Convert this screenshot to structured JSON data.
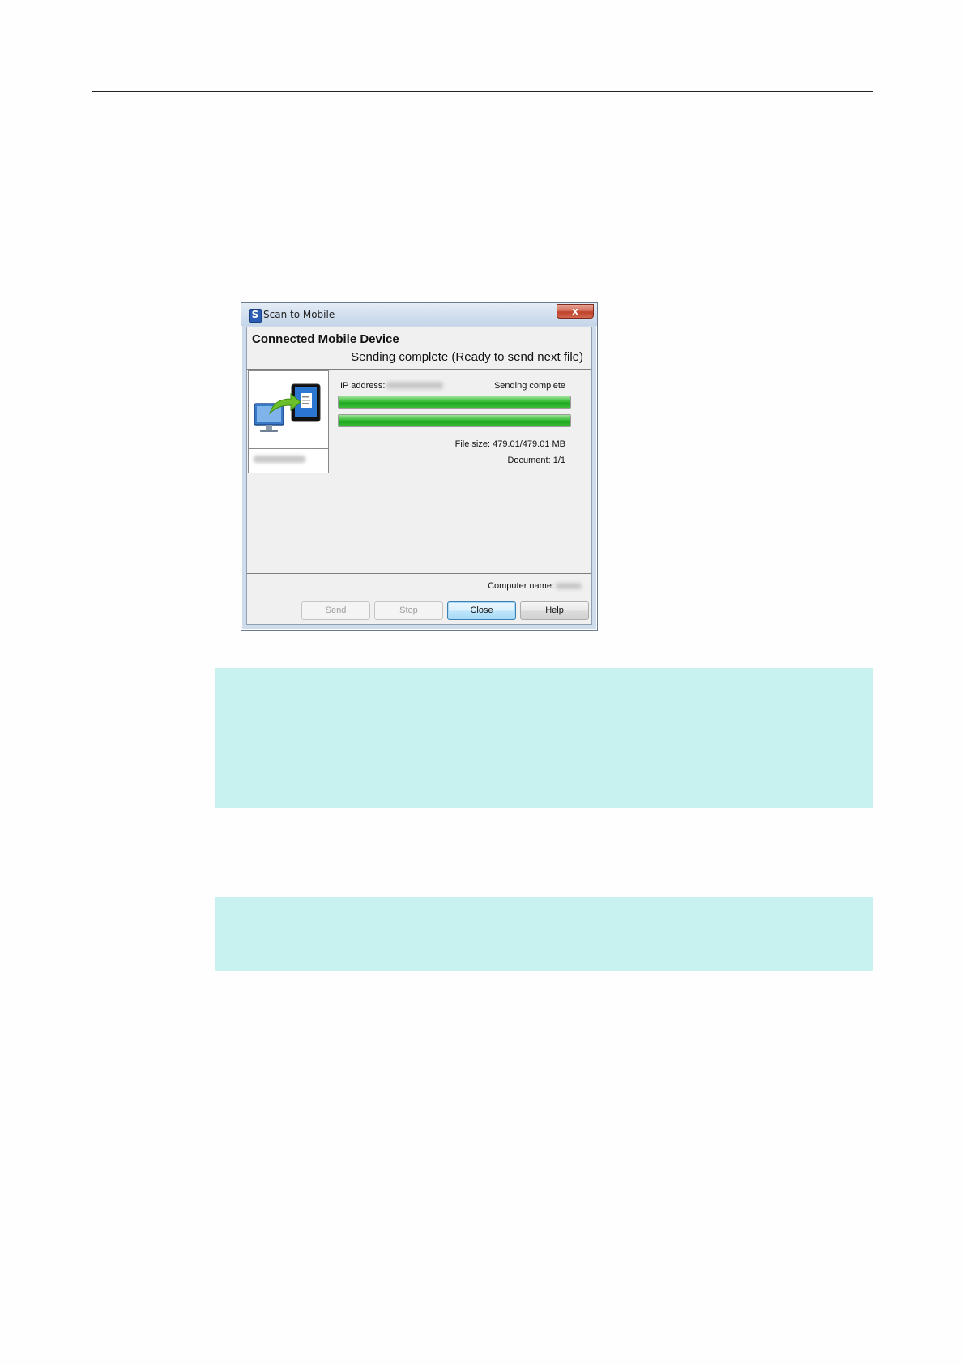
{
  "dialog": {
    "title": "Scan to Mobile",
    "close_glyph": "x",
    "header_title": "Connected Mobile Device",
    "header_status": "Sending complete (Ready to send next file)",
    "ip_label": "IP address:",
    "send_status": "Sending complete",
    "progress_file": 1.0,
    "progress_total": 1.0,
    "file_size": "File size: 479.01/479.01 MB",
    "document": "Document: 1/1",
    "computer_name_label": "Computer name:",
    "buttons": {
      "send": "Send",
      "stop": "Stop",
      "close": "Close",
      "help": "Help"
    }
  },
  "icons": [
    "app-s-icon",
    "close-icon",
    "computer-to-mobile-icon"
  ],
  "colors": {
    "note_background": "#c8f2f0",
    "progress_green": "#1fa81f"
  }
}
